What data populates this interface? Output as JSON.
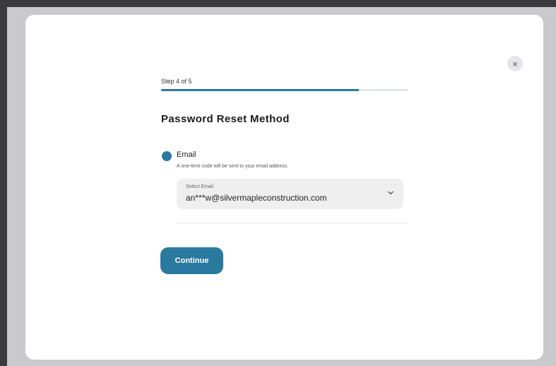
{
  "step": {
    "label": "Step 4 of 5",
    "progress_fraction": 0.8
  },
  "title": "Password Reset Method",
  "option": {
    "label": "Email",
    "description": "A one-time code will be sent to your email address.",
    "selected": true
  },
  "select": {
    "caption": "Select Email",
    "value": "an***w@silvermapleconstruction.com"
  },
  "continue_label": "Continue",
  "close_icon": "×",
  "colors": {
    "accent": "#2a7aa0",
    "track": "#e1e7ee",
    "select_bg": "#efefef"
  },
  "icons": [
    "close-icon",
    "chevron-down-icon"
  ]
}
